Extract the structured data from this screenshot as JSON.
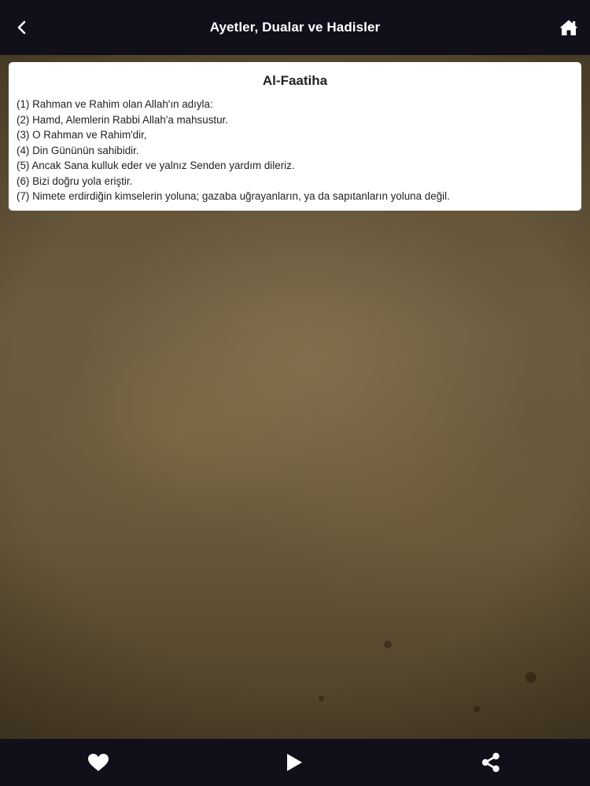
{
  "header": {
    "title": "Ayetler, Dualar ve Hadisler",
    "back_icon": "chevron-left-icon",
    "home_icon": "home-icon"
  },
  "card": {
    "title": "Al-Faatiha",
    "verses": [
      "(1) Rahman ve Rahim olan Allah'ın adıyla:",
      "(2) Hamd, Alemlerin Rabbi Allah'a mahsustur.",
      "(3) O Rahman ve Rahim'dir,",
      "(4) Din Gününün sahibidir.",
      "(5) Ancak Sana kulluk eder ve yalnız Senden yardım dileriz.",
      "(6) Bizi doğru yola eriştir.",
      "(7) Nimete erdirdiğin kimselerin yoluna; gazaba uğrayanların, ya da sapıtanların yoluna değil."
    ]
  },
  "bottom_bar": {
    "favorite_icon": "heart-icon",
    "play_icon": "play-icon",
    "share_icon": "share-icon"
  },
  "colors": {
    "bar_background": "#110f1a",
    "card_background": "#ffffff",
    "icon_color": "#ffffff"
  }
}
